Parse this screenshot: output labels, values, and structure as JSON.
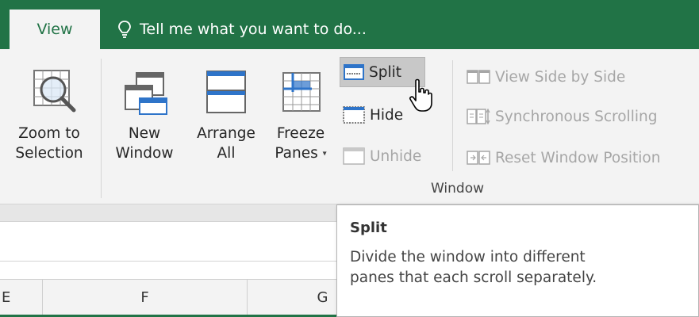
{
  "tabs": {
    "view_label": "View",
    "tell_me_placeholder": "Tell me what you want to do..."
  },
  "ribbon": {
    "zoom_to_selection": {
      "line1": "Zoom to",
      "line2": "Selection"
    },
    "new_window": {
      "line1": "New",
      "line2": "Window"
    },
    "arrange_all": {
      "line1": "Arrange",
      "line2": "All"
    },
    "freeze_panes": {
      "line1": "Freeze",
      "line2": "Panes",
      "caret": "▾"
    },
    "split": "Split",
    "hide": "Hide",
    "unhide": "Unhide",
    "view_side_by_side": "View Side by Side",
    "synchronous_scrolling": "Synchronous Scrolling",
    "reset_window_position": "Reset Window Position",
    "window_group_label": "Window"
  },
  "columns": [
    "E",
    "F",
    "G"
  ],
  "tooltip": {
    "title": "Split",
    "line1": "Divide the window into different",
    "line2": "panes that each scroll separately."
  },
  "colors": {
    "accent_green": "#217346",
    "ribbon_bg": "#f3f3f3",
    "icon_blue": "#2e74c9"
  }
}
